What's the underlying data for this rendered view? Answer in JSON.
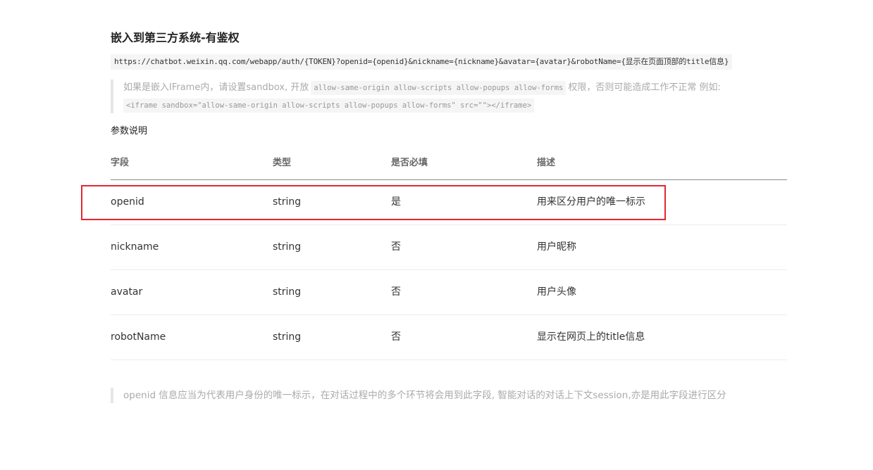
{
  "section": {
    "title": "嵌入到第三方系统-有鉴权",
    "url": "https://chatbot.weixin.qq.com/webapp/auth/{TOKEN}?openid={openid}&nickname={nickname}&avatar={avatar}&robotName={显示在页面顶部的title信息}"
  },
  "note_iframe": {
    "text_before": "如果是嵌入IFrame内，请设置sandbox, 开放",
    "code_permissions": "allow-same-origin allow-scripts allow-popups allow-forms",
    "text_after": "权限，否则可能造成工作不正常 例如:",
    "code_example": "<iframe sandbox=\"allow-same-origin allow-scripts allow-popups allow-forms\" src=\"\"></iframe>"
  },
  "params": {
    "title": "参数说明",
    "headers": [
      "字段",
      "类型",
      "是否必填",
      "描述"
    ],
    "rows": [
      [
        "openid",
        "string",
        "是",
        "用来区分用户的唯一标示"
      ],
      [
        "nickname",
        "string",
        "否",
        "用户昵称"
      ],
      [
        "avatar",
        "string",
        "否",
        "用户头像"
      ],
      [
        "robotName",
        "string",
        "否",
        "显示在网页上的title信息"
      ]
    ]
  },
  "note_openid": {
    "text": "openid 信息应当为代表用户身份的唯一标示，在对话过程中的多个环节将会用到此字段, 智能对话的对话上下文session,亦是用此字段进行区分"
  },
  "colors": {
    "highlight": "#e3262f",
    "note_text": "#aaaaaa",
    "code_bg": "#f5f5f5"
  }
}
